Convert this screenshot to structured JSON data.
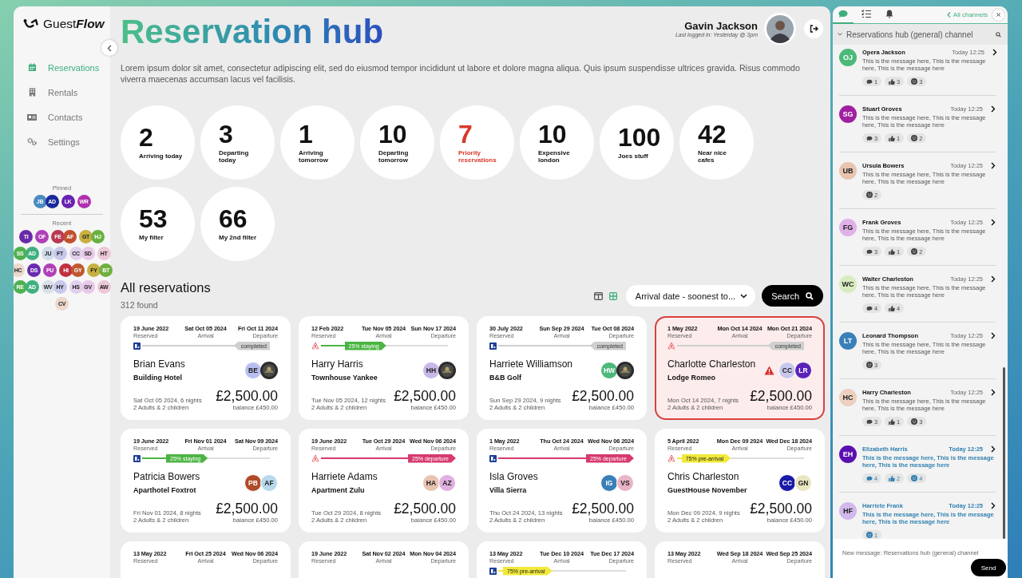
{
  "sidebar": {
    "logo": {
      "text": "Guest",
      "emphasis": "Flow"
    },
    "nav": [
      {
        "label": "Reservations",
        "selected": true
      },
      {
        "label": "Rentals",
        "selected": false
      },
      {
        "label": "Contacts",
        "selected": false
      },
      {
        "label": "Settings",
        "selected": false
      }
    ],
    "pinned_label": "Pinned",
    "pinned": [
      [
        {
          "initials": "JB",
          "color": "#4a8ac0"
        },
        {
          "initials": "AD",
          "color": "#1a2a9a"
        }
      ],
      [
        {
          "initials": "LK",
          "color": "#6a22b0"
        }
      ],
      [
        {
          "initials": "WR",
          "color": "#b030b0"
        }
      ]
    ],
    "recent_label": "Recent",
    "recent_rows": [
      [
        [
          {
            "initials": "TI",
            "color": "#6a2aa8"
          }
        ],
        [
          {
            "initials": "OF",
            "color": "#b040b8"
          }
        ],
        [
          {
            "initials": "FE",
            "color": "#b83a50"
          },
          {
            "initials": "AF",
            "color": "#c05030"
          }
        ],
        [
          {
            "initials": "GT",
            "color": "#c8b040"
          },
          {
            "initials": "HJ",
            "color": "#6ab040"
          }
        ]
      ],
      [
        [
          {
            "initials": "SS",
            "color": "#50b050"
          },
          {
            "initials": "AD",
            "color": "#40b080"
          }
        ],
        [
          {
            "initials": "JU",
            "color": "#d0dcea"
          },
          {
            "initials": "FT",
            "color": "#c8c8ec"
          }
        ],
        [
          {
            "initials": "CC",
            "color": "#e0d0ec"
          },
          {
            "initials": "SD",
            "color": "#e8c8e8"
          }
        ],
        [
          {
            "initials": "HT",
            "color": "#ecc8d8"
          }
        ]
      ],
      [
        [
          {
            "initials": "HC",
            "color": "#ecd8cc"
          }
        ],
        [
          {
            "initials": "DS",
            "color": "#6a2ab0"
          }
        ],
        [
          {
            "initials": "PU",
            "color": "#b040b8"
          }
        ],
        [
          {
            "initials": "HI",
            "color": "#c03040"
          },
          {
            "initials": "GY",
            "color": "#c05830"
          }
        ],
        [
          {
            "initials": "FY",
            "color": "#c8b040"
          },
          {
            "initials": "BT",
            "color": "#70b040"
          }
        ]
      ],
      [
        [
          {
            "initials": "RE",
            "color": "#50b050"
          },
          {
            "initials": "AD",
            "color": "#40b080"
          }
        ],
        [
          {
            "initials": "WV",
            "color": "#d8e0ea"
          },
          {
            "initials": "HY",
            "color": "#c8c8ec"
          }
        ],
        [
          {
            "initials": "HS",
            "color": "#e0d0ec"
          },
          {
            "initials": "GV",
            "color": "#e8c8e8"
          }
        ],
        [
          {
            "initials": "AW",
            "color": "#ecc8d8"
          }
        ]
      ],
      [
        [
          {
            "initials": "CV",
            "color": "#ecd8cc"
          }
        ]
      ]
    ]
  },
  "header": {
    "title": "Reservation hub",
    "description": "Lorem ipsum dolor sit amet, consectetur adipiscing elit, sed do eiusmod tempor incididunt ut labore et dolore magna aliqua. Quis ipsum suspendisse ultrices gravida. Risus commodo viverra maecenas accumsan lacus vel facilisis.",
    "user_name": "Gavin Jackson",
    "last_login": "Last logged in: Yesterday @ 3pm"
  },
  "stats": [
    {
      "value": "2",
      "label": "Arriving today",
      "alert": false
    },
    {
      "value": "3",
      "label": "Departing today",
      "alert": false
    },
    {
      "value": "1",
      "label": "Arriving tomorrow",
      "alert": false
    },
    {
      "value": "10",
      "label": "Departing tomorrow",
      "alert": false
    },
    {
      "value": "7",
      "label": "Priority reservations",
      "alert": true
    },
    {
      "value": "10",
      "label": "Expensive london",
      "alert": false
    },
    {
      "value": "100",
      "label": "Joes stuff",
      "alert": false
    },
    {
      "value": "42",
      "label": "Near nice cafes",
      "alert": false
    },
    {
      "value": "53",
      "label": "My filter",
      "alert": false
    },
    {
      "value": "66",
      "label": "My 2nd filter",
      "alert": false
    }
  ],
  "listing": {
    "title": "All reservations",
    "count": "312 found",
    "views": [
      {
        "selected": false
      },
      {
        "selected": true
      }
    ],
    "sort": "Arrival date - soonest to...",
    "search_button": "Search"
  },
  "cards": [
    {
      "dates": [
        {
          "date": "19 June 2022",
          "label": "Reserved"
        },
        {
          "date": "Sat Oct 05 2024",
          "label": "Arrival"
        },
        {
          "date": "Fri Oct 11 2024",
          "label": "Departure"
        }
      ],
      "channel": {
        "kind": "booking"
      },
      "progress": {
        "kind": "completed",
        "level": 1,
        "label": "completed"
      },
      "guest": "Brian Evans",
      "property": "Building Hotel",
      "avatars": [
        {
          "kind": "initials",
          "initials": "BE",
          "color": "#b8bff0"
        },
        {
          "kind": "picture"
        }
      ],
      "warning": false,
      "flagged": false,
      "summary": "Sat Oct 05 2024, 6 nights",
      "guests": "2 Adults & 2 children",
      "price": "£2,500.00",
      "balance": "balance £450.00"
    },
    {
      "dates": [
        {
          "date": "12 Feb 2022",
          "label": "Reserved"
        },
        {
          "date": "Tue Nov 05 2024",
          "label": "Arrival"
        },
        {
          "date": "Sun Nov 17 2024",
          "label": "Departure"
        }
      ],
      "channel": {
        "kind": "airbnb"
      },
      "progress": {
        "kind": "staying",
        "level": 0.45,
        "label": "25% staying"
      },
      "guest": "Harry Harris",
      "property": "Townhouse Yankee",
      "avatars": [
        {
          "kind": "initials",
          "initials": "HH",
          "color": "#c8b8e8"
        },
        {
          "kind": "picture"
        }
      ],
      "warning": false,
      "flagged": false,
      "summary": "Tue Nov 05 2024, 12 nights",
      "guests": "2 Adults & 2 children",
      "price": "£2,500.00",
      "balance": "balance £450.00"
    },
    {
      "dates": [
        {
          "date": "30 July 2022",
          "label": "Reserved"
        },
        {
          "date": "Sun Sep 29 2024",
          "label": "Arrival"
        },
        {
          "date": "Tue Oct 08 2024",
          "label": "Departure"
        }
      ],
      "channel": {
        "kind": "booking"
      },
      "progress": {
        "kind": "completed",
        "level": 1,
        "label": "completed"
      },
      "guest": "Harriete Williamson",
      "property": "B&B Golf",
      "avatars": [
        {
          "kind": "initials",
          "initials": "HW",
          "color": "#4cb87a"
        },
        {
          "kind": "picture"
        }
      ],
      "warning": false,
      "flagged": false,
      "summary": "Sun Sep 29 2024, 9 nights",
      "guests": "2 Adults & 2 children",
      "price": "£2,500.00",
      "balance": "balance £450.00"
    },
    {
      "dates": [
        {
          "date": "1 May 2022",
          "label": "Reserved"
        },
        {
          "date": "Mon Oct 14 2024",
          "label": "Arrival"
        },
        {
          "date": "Mon Oct 21 2024",
          "label": "Departure"
        }
      ],
      "channel": {
        "kind": "airbnb"
      },
      "progress": {
        "kind": "completed",
        "level": 1,
        "label": "completed"
      },
      "guest": "Charlotte Charleston",
      "property": "Lodge Romeo",
      "avatars": [
        {
          "kind": "initials",
          "initials": "CC",
          "color": "#c8c8ec"
        },
        {
          "kind": "initials",
          "initials": "LR",
          "color": "#5a22b8"
        }
      ],
      "warning": true,
      "flagged": true,
      "summary": "Mon Oct 14 2024, 7 nights",
      "guests": "2 Adults & 2 children",
      "price": "£2,500.00",
      "balance": "balance £450.00"
    },
    {
      "dates": [
        {
          "date": "19 June 2022",
          "label": "Reserved"
        },
        {
          "date": "Fri Nov 01 2024",
          "label": "Arrival"
        },
        {
          "date": "Sat Nov 09 2024",
          "label": "Departure"
        }
      ],
      "channel": {
        "kind": "booking"
      },
      "progress": {
        "kind": "staying",
        "level": 0.45,
        "label": "25% staying"
      },
      "guest": "Patricia Bowers",
      "property": "Aparthotel Foxtrot",
      "avatars": [
        {
          "kind": "initials",
          "initials": "PB",
          "color": "#b04a28"
        },
        {
          "kind": "initials",
          "initials": "AF",
          "color": "#b8d8ec"
        }
      ],
      "warning": false,
      "flagged": false,
      "summary": "Fri Nov 01 2024, 8 nights",
      "guests": "2 Adults & 2 children",
      "price": "£2,500.00",
      "balance": "balance £450.00"
    },
    {
      "dates": [
        {
          "date": "19 June 2022",
          "label": "Reserved"
        },
        {
          "date": "Tue Oct 29 2024",
          "label": "Arrival"
        },
        {
          "date": "Wed Nov 06 2024",
          "label": "Departure"
        }
      ],
      "channel": {
        "kind": "airbnb"
      },
      "progress": {
        "kind": "departure",
        "level": 0.95,
        "label": "25% departure"
      },
      "guest": "Harriete Adams",
      "property": "Apartment Zulu",
      "avatars": [
        {
          "kind": "initials",
          "initials": "HA",
          "color": "#e8c4b0"
        },
        {
          "kind": "initials",
          "initials": "AZ",
          "color": "#e0b0e0"
        }
      ],
      "warning": false,
      "flagged": false,
      "summary": "Tue Oct 29 2024, 8 nights",
      "guests": "2 Adults & 2 children",
      "price": "£2,500.00",
      "balance": "balance £450.00"
    },
    {
      "dates": [
        {
          "date": "1 May 2022",
          "label": "Reserved"
        },
        {
          "date": "Thu Oct 24 2024",
          "label": "Arrival"
        },
        {
          "date": "Wed Nov 06 2024",
          "label": "Departure"
        }
      ],
      "channel": {
        "kind": "booking"
      },
      "progress": {
        "kind": "departure",
        "level": 0.95,
        "label": "25% departure"
      },
      "guest": "Isla Groves",
      "property": "Villa Sierra",
      "avatars": [
        {
          "kind": "initials",
          "initials": "IG",
          "color": "#3a80b8"
        },
        {
          "kind": "initials",
          "initials": "VS",
          "color": "#e8b4c8"
        }
      ],
      "warning": false,
      "flagged": false,
      "summary": "Thu Oct 24 2024, 13 nights",
      "guests": "2 Adults & 2 children",
      "price": "£2,500.00",
      "balance": "balance £450.00"
    },
    {
      "dates": [
        {
          "date": "5 April 2022",
          "label": "Reserved"
        },
        {
          "date": "Mon Dec 09 2024",
          "label": "Arrival"
        },
        {
          "date": "Wed Dec 18 2024",
          "label": "Departure"
        }
      ],
      "channel": {
        "kind": "airbnb"
      },
      "progress": {
        "kind": "pre-arrival",
        "level": 0.3,
        "label": "75% pre-arrival"
      },
      "guest": "Chris Charleston",
      "property": "GuestHouse November",
      "avatars": [
        {
          "kind": "initials",
          "initials": "CC",
          "color": "#1a1aa8"
        },
        {
          "kind": "initials",
          "initials": "GN",
          "color": "#e8e6c0"
        }
      ],
      "warning": false,
      "flagged": false,
      "summary": "Mon Dec 09 2024, 9 nights",
      "guests": "2 Adults & 2 children",
      "price": "£2,500.00",
      "balance": "balance £450.00"
    },
    {
      "dates": [
        {
          "date": "13 May 2022",
          "label": "Reserved"
        },
        {
          "date": "Fri Oct 25 2024",
          "label": "Arrival"
        },
        {
          "date": "Wed Nov 06 2024",
          "label": "Departure"
        }
      ],
      "flagged": false
    },
    {
      "dates": [
        {
          "date": "19 June 2022",
          "label": "Reserved"
        },
        {
          "date": "Sat Nov 02 2024",
          "label": "Arrival"
        },
        {
          "date": "Mon Nov 04 2024",
          "label": "Departure"
        }
      ],
      "flagged": false
    },
    {
      "dates": [
        {
          "date": "13 May 2022",
          "label": "Reserved"
        },
        {
          "date": "Tue Dec 10 2024",
          "label": "Arrival"
        },
        {
          "date": "Tue Dec 17 2024",
          "label": "Departure"
        }
      ],
      "channel": {
        "kind": "booking"
      },
      "progress": {
        "kind": "pre-arrival",
        "level": 0.3,
        "label": "75% pre-arrival"
      },
      "flagged": false
    },
    {
      "dates": [
        {
          "date": "13 May 2022",
          "label": "Reserved"
        },
        {
          "date": "Wed Sep 18 2024",
          "label": "Arrival"
        },
        {
          "date": "Wed Sep 25 2024",
          "label": "Departure"
        }
      ],
      "flagged": false
    }
  ],
  "chat": {
    "tabs": [
      {
        "selected": true
      },
      {
        "selected": false
      },
      {
        "selected": false
      }
    ],
    "all_channels": "All channels",
    "channel_title": "Reservations hub (general) channel",
    "messages": [
      {
        "initials": "OJ",
        "color": "#4cb87a",
        "name": "Opera Jackson",
        "time": "Today 12:25",
        "text": "This is the message here, This is the message here, This is the message here",
        "unread": false,
        "reactions": [
          {
            "kind": "comment",
            "count": "1"
          },
          {
            "kind": "like",
            "count": "3"
          },
          {
            "kind": "emoji",
            "count": "3"
          }
        ]
      },
      {
        "initials": "SG",
        "color": "#a020a0",
        "name": "Stuart Groves",
        "time": "Today 12:25",
        "text": "This is the message here, This is the message here, This is the message here",
        "unread": false,
        "reactions": [
          {
            "kind": "comment",
            "count": "3"
          },
          {
            "kind": "like",
            "count": "1"
          },
          {
            "kind": "emoji",
            "count": "2"
          }
        ]
      },
      {
        "initials": "UB",
        "color": "#e8c4b0",
        "name": "Ursula Bowers",
        "time": "Today 12:25",
        "text": "This is the message here, This is the message here, This is the message here",
        "unread": false,
        "reactions": [
          {
            "kind": "emoji",
            "count": "2"
          }
        ]
      },
      {
        "initials": "FG",
        "color": "#e0b0e8",
        "name": "Frank Groves",
        "time": "Today 12:25",
        "text": "This is the message here, This is the message here, This is the message here",
        "unread": false,
        "reactions": [
          {
            "kind": "comment",
            "count": "3"
          },
          {
            "kind": "like",
            "count": "1"
          },
          {
            "kind": "emoji",
            "count": "2"
          }
        ]
      },
      {
        "initials": "WC",
        "color": "#d8ecc0",
        "name": "Walter Charleston",
        "time": "Today 12:25",
        "text": "This is the message here, This is the message here, This is the message here",
        "unread": false,
        "reactions": [
          {
            "kind": "comment",
            "count": "4"
          },
          {
            "kind": "like",
            "count": "4"
          }
        ]
      },
      {
        "initials": "LT",
        "color": "#3a80b8",
        "name": "Leonard Thompson",
        "time": "Today 12:25",
        "text": "This is the message here, This is the message here, This is the message here",
        "unread": false,
        "reactions": [
          {
            "kind": "emoji",
            "count": "3"
          }
        ]
      },
      {
        "initials": "HC",
        "color": "#ecd0c0",
        "name": "Harry Charleston",
        "time": "Today 12:25",
        "text": "This is the message here, This is the message here, This is the message here",
        "unread": false,
        "reactions": [
          {
            "kind": "comment",
            "count": "3"
          },
          {
            "kind": "like",
            "count": "1"
          },
          {
            "kind": "emoji",
            "count": "3"
          }
        ]
      },
      {
        "initials": "EH",
        "color": "#5a10b0",
        "name": "Elizabeth Harris",
        "time": "Today 12:25",
        "text": "This is the message here, This is the message here, This is the message here",
        "unread": true,
        "reactions": [
          {
            "kind": "comment",
            "count": "4"
          },
          {
            "kind": "like",
            "count": "2"
          },
          {
            "kind": "emoji",
            "count": "4"
          }
        ]
      },
      {
        "initials": "HF",
        "color": "#d0b8ec",
        "name": "Harriete Frank",
        "time": "Today 12:25",
        "text": "This is the message here, This is the message here, This is the message here",
        "unread": true,
        "reactions": [
          {
            "kind": "emoji",
            "count": "1"
          }
        ]
      }
    ],
    "composer_placeholder": "New message: Reservations hub (general) channel",
    "send_button": "Send"
  }
}
